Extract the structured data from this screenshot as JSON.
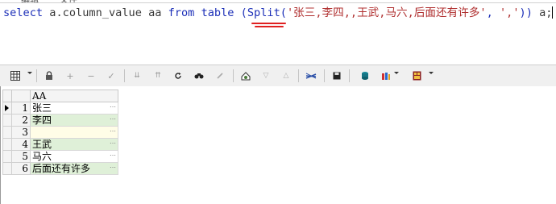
{
  "menu_strip": {
    "items": [
      "编辑",
      "文件"
    ]
  },
  "editor": {
    "sql_keyword_select": "select",
    "sql_column": "a.column_value",
    "sql_alias": "aa",
    "sql_keyword_from": "from",
    "sql_table": "table",
    "sql_open_paren": "(",
    "sql_function": "Split",
    "sql_fn_paren": "(",
    "sql_string_1": "'张三,李四,,王武,马六,后面还有许多'",
    "sql_comma": ",",
    "sql_string_2": "','",
    "sql_close": "))",
    "sql_tail_alias": "a;",
    "colors": {
      "keyword": "#1c2fb8",
      "string": "#b03030",
      "annotation": "#e02020"
    }
  },
  "toolbar": {
    "icons": [
      "grid-view-icon",
      "lock-icon",
      "add-record-icon",
      "delete-record-icon",
      "post-icon",
      "first-record-icon",
      "last-record-icon",
      "refresh-icon",
      "find-icon",
      "clear-icon",
      "query-icon",
      "sort-down-icon",
      "sort-up-icon",
      "chart-icon",
      "save-icon",
      "export-icon",
      "print-icon",
      "report-icon"
    ]
  },
  "grid": {
    "column_header": "AA",
    "rows": [
      {
        "num": "1",
        "value": "张三",
        "current": true
      },
      {
        "num": "2",
        "value": "李四"
      },
      {
        "num": "3",
        "value": ""
      },
      {
        "num": "4",
        "value": "王武"
      },
      {
        "num": "5",
        "value": "马六"
      },
      {
        "num": "6",
        "value": "后面还有许多"
      }
    ],
    "ellipsis": "…",
    "colors": {
      "alt_row": "#dff0d8",
      "null_row": "#fffde7"
    }
  }
}
